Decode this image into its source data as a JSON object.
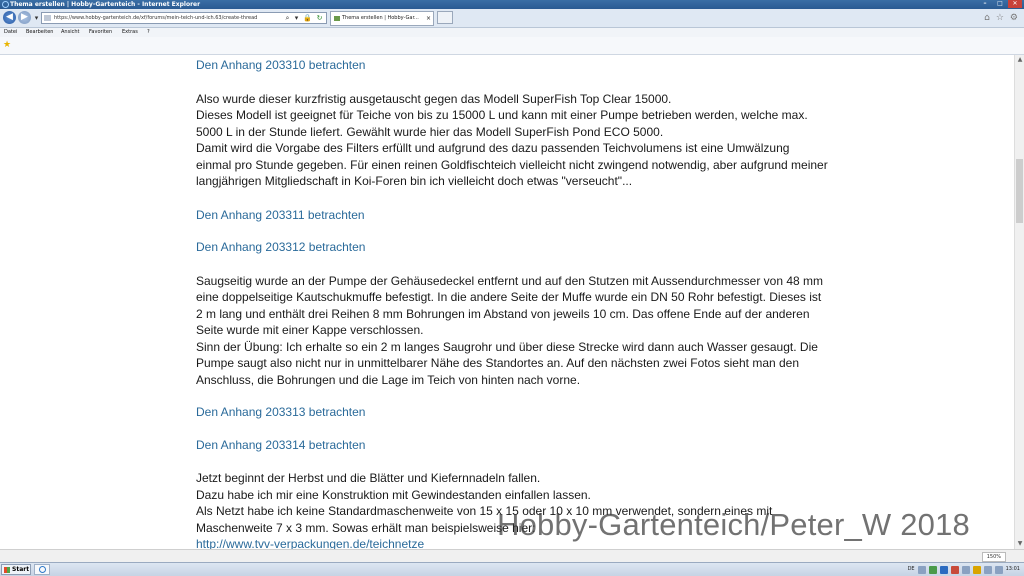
{
  "window": {
    "title": "Thema erstellen | Hobby-Gartenteich - Internet Explorer"
  },
  "address": {
    "url": "https://www.hobby-gartenteich.de/xf/forums/mein-teich-und-ich.63/create-thread"
  },
  "tab": {
    "label": "Thema erstellen | Hobby-Gar...",
    "close": "×"
  },
  "menu": {
    "items": [
      "Datei",
      "Bearbeiten",
      "Ansicht",
      "Favoriten",
      "Extras",
      "?"
    ]
  },
  "article": {
    "att1": "Den Anhang 203310 betrachten",
    "p1": "Also wurde dieser kurzfristig ausgetauscht gegen das Modell SuperFish Top Clear 15000.",
    "p2": "Dieses Modell ist geeignet für Teiche von bis zu 15000 L und kann mit einer Pumpe betrieben werden, welche max. 5000 L in der Stunde liefert. Gewählt wurde hier das Modell SuperFish Pond ECO 5000.",
    "p3": "Damit wird die Vorgabe des Filters erfüllt und aufgrund des dazu passenden Teichvolumens ist eine Umwälzung einmal pro Stunde gegeben. Für einen reinen Goldfischteich vielleicht nicht zwingend notwendig, aber aufgrund meiner langjährigen Mitgliedschaft in Koi-Foren bin ich vielleicht doch etwas \"verseucht\"...",
    "att2": "Den Anhang 203311 betrachten",
    "att3": "Den Anhang 203312 betrachten",
    "p4": "Saugseitig wurde an der Pumpe der Gehäusedeckel entfernt und auf den Stutzen mit Aussendurchmesser von 48 mm eine doppelseitige Kautschukmuffe befestigt. In die andere Seite der Muffe wurde ein DN 50 Rohr befestigt. Dieses ist 2 m lang und enthält drei Reihen 8 mm Bohrungen im Abstand von jeweils 10 cm. Das offene Ende auf der anderen Seite wurde mit einer Kappe verschlossen.",
    "p5": "Sinn der Übung: Ich erhalte so ein 2 m langes Saugrohr und über diese Strecke wird dann auch Wasser gesaugt. Die Pumpe saugt also nicht nur in unmittelbarer Nähe des Standortes an. Auf den nächsten zwei Fotos sieht man den Anschluss, die Bohrungen und die Lage im Teich von hinten nach vorne.",
    "att4": "Den Anhang 203313 betrachten",
    "att5": "Den Anhang 203314 betrachten",
    "p6": "Jetzt beginnt der Herbst und die Blätter und Kiefernnadeln fallen.",
    "p7": "Dazu habe ich mir eine Konstruktion mit Gewindestanden einfallen lassen.",
    "p8": "Als Netzt habe ich keine Standardmaschenweite von 15 x 15 oder 10 x 10 mm verwendet, sondern eines mit Maschenweite 7 x 3 mm. Sowas erhält man beispielsweise hier:",
    "link": "http://www.tvv-verpackungen.de/teichnetze"
  },
  "watermark": "Hobby-Gartenteich/Peter_W 2018",
  "status": {
    "zoom": "150%"
  },
  "taskbar": {
    "start": "Start",
    "lang": "DE",
    "time": "13:01"
  }
}
